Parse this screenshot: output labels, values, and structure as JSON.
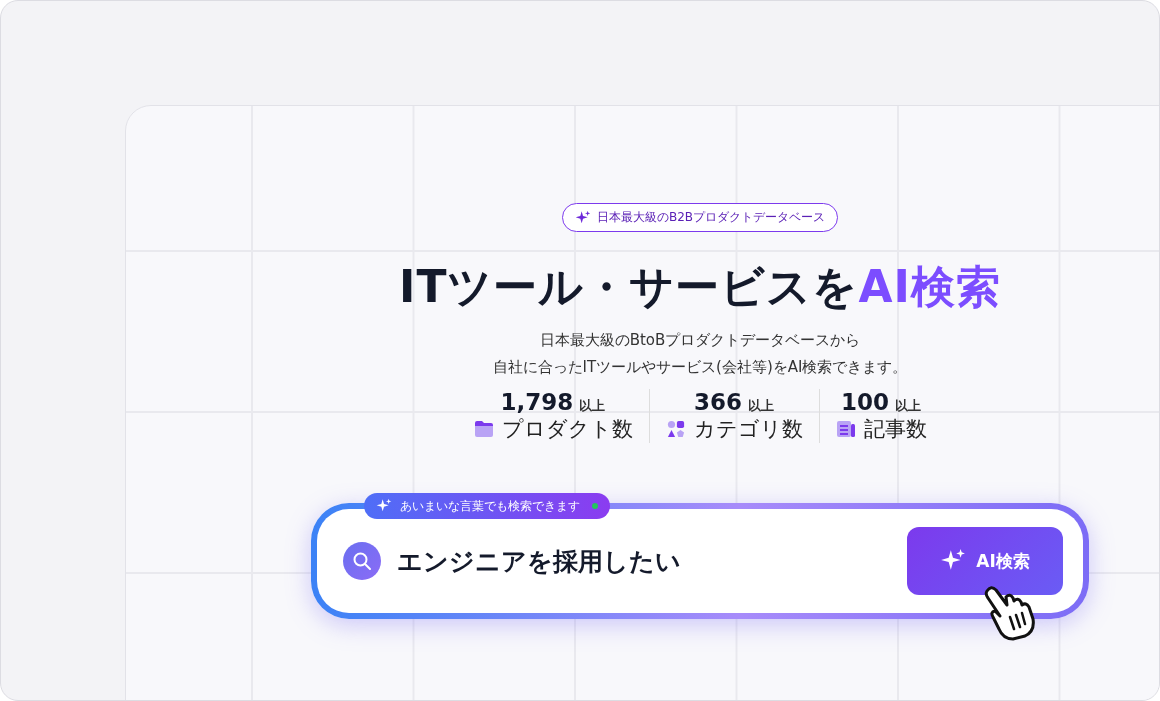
{
  "badge": {
    "label": "日本最大級のB2Bプロダクトデータベース"
  },
  "headline": {
    "text": "ITツール・サービスを",
    "highlight": "AI検索"
  },
  "description": [
    "日本最大級のBtoBプロダクトデータベースから",
    "自社に合ったITツールやサービス(会社等)をAI検索できます。"
  ],
  "stats": [
    {
      "kind": "folder",
      "value": "1,798",
      "suffix": "以上",
      "label": "プロダクト数"
    },
    {
      "kind": "shapes",
      "value": "366",
      "suffix": "以上",
      "label": "カテゴリ数"
    },
    {
      "kind": "article",
      "value": "100",
      "suffix": "以上",
      "label": "記事数"
    }
  ],
  "search": {
    "hint": "あいまいな言葉でも検索できます",
    "value": "エンジニアを採用したい",
    "button": "AI検索"
  }
}
